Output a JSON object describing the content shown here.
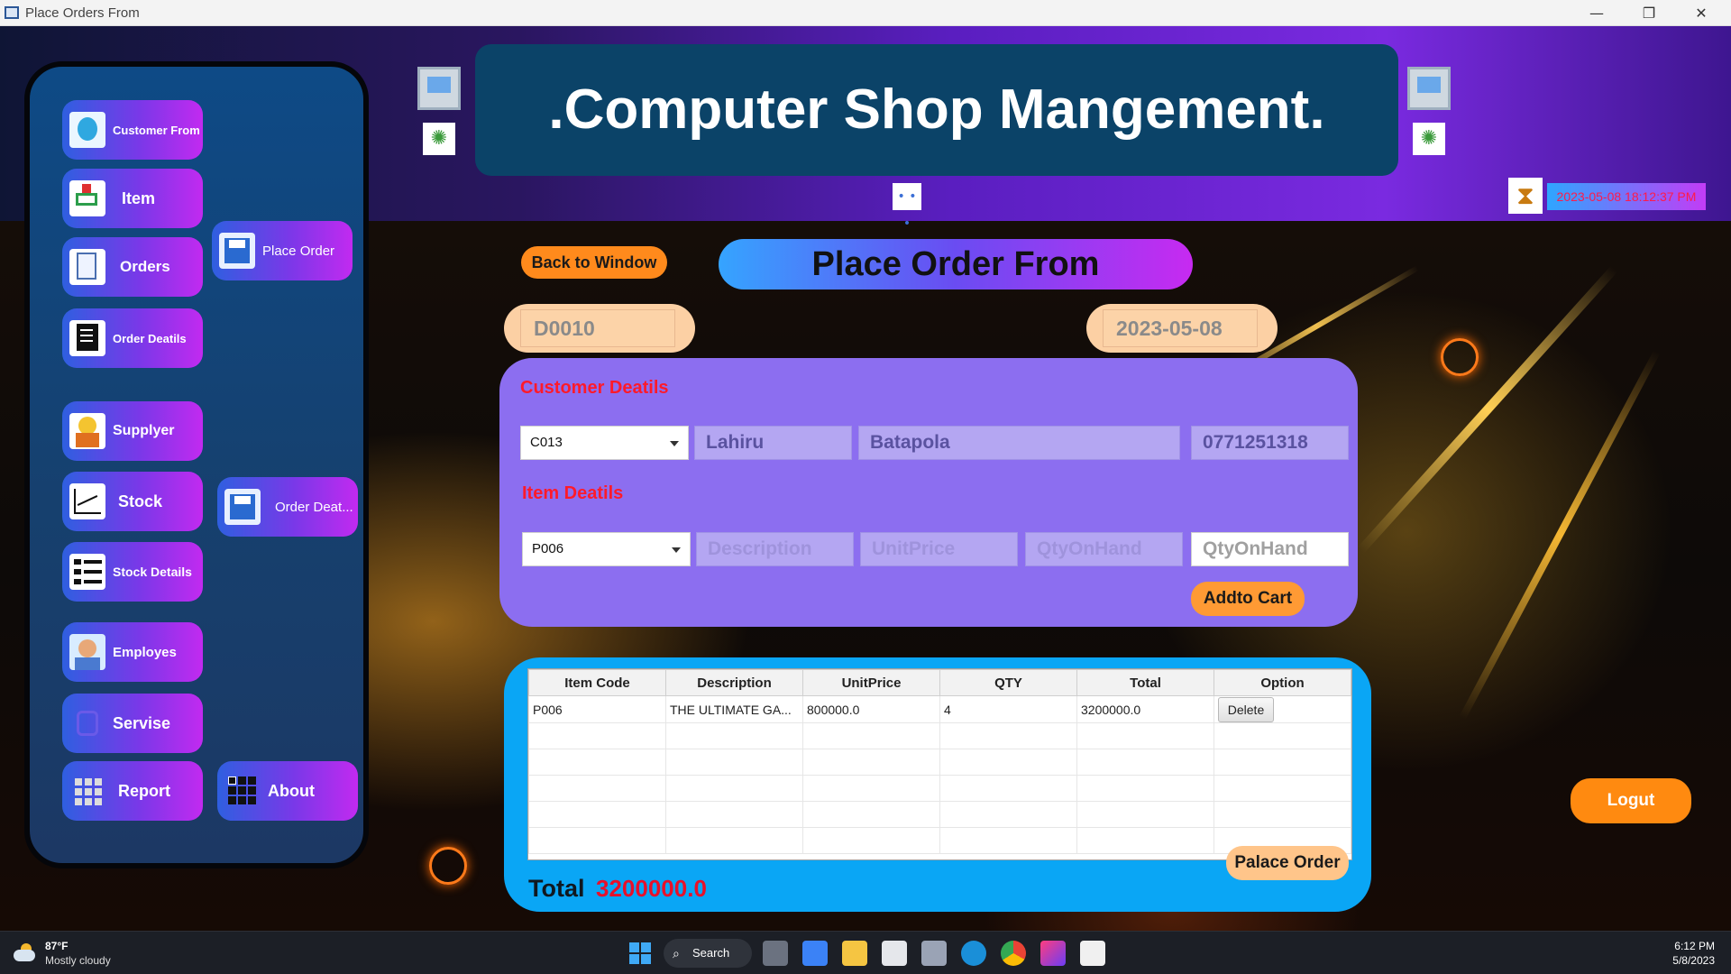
{
  "window_title": "Place Orders From",
  "titlebar_buttons": {
    "minimize": "—",
    "restore": "❐",
    "close": "✕"
  },
  "header": {
    "title": ".Computer Shop Mangement."
  },
  "datetime": "2023-05-08  18:12:37 PM",
  "sidebar": {
    "items": [
      {
        "label": "Customer From",
        "icon": "customer-icon"
      },
      {
        "label": "Item",
        "icon": "cart-icon"
      },
      {
        "label": "Orders",
        "icon": "orders-document-icon"
      },
      {
        "label": "Order Deatils",
        "icon": "order-details-icon"
      },
      {
        "label": "Supplyer",
        "icon": "supplier-icon"
      },
      {
        "label": "Stock",
        "icon": "stock-chart-icon"
      },
      {
        "label": "Stock Details",
        "icon": "list-icon"
      },
      {
        "label": "Employes",
        "icon": "employee-icon"
      },
      {
        "label": "Servise",
        "icon": "service-icon"
      },
      {
        "label": "Report",
        "icon": "grid-icon"
      },
      {
        "label": "Place Order",
        "icon": "floppy-disk-icon"
      },
      {
        "label": "Order Deat...",
        "icon": "floppy-disk-icon"
      },
      {
        "label": "About",
        "icon": "grid-icon"
      }
    ]
  },
  "form": {
    "back_button": "Back to Window",
    "title": "Place Order From",
    "order_id": "D0010",
    "order_date": "2023-05-08",
    "customer_section_label": "Customer Deatils",
    "customer": {
      "id": "C013",
      "name": "Lahiru",
      "address": "Batapola",
      "phone": "0771251318"
    },
    "item_section_label": "Item Deatils",
    "item": {
      "code": "P006",
      "description_placeholder": "Description",
      "unitprice_placeholder": "UnitPrice",
      "qtyonhand_placeholder": "QtyOnHand",
      "qty_placeholder": "QtyOnHand"
    },
    "add_to_cart": "Addto Cart"
  },
  "cart": {
    "columns": [
      "Item Code",
      "Description",
      "UnitPrice",
      "QTY",
      "Total",
      "Option"
    ],
    "rows": [
      {
        "code": "P006",
        "description": "THE ULTIMATE GA...",
        "unitprice": "800000.0",
        "qty": "4",
        "total": "3200000.0",
        "option": "Delete"
      }
    ],
    "total_label": "Total",
    "total_value": "3200000.0",
    "place_order": "Palace Order"
  },
  "logout": "Logut",
  "taskbar": {
    "weather_temp": "87°F",
    "weather_desc": "Mostly cloudy",
    "search": "Search",
    "time": "6:12 PM",
    "date": "5/8/2023"
  }
}
